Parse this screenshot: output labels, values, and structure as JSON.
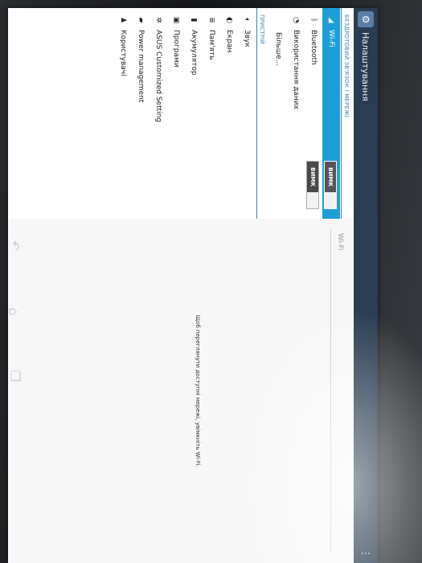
{
  "action_bar": {
    "title": "Налаштування"
  },
  "sections": {
    "wireless_header": "БЕЗДРОТОВИЙ ЗВ'ЯЗОК І МЕРЕЖІ",
    "device_header": "ПРИСТРІЙ"
  },
  "items": {
    "wifi": {
      "label": "Wi-Fi",
      "toggle": "ВИМК"
    },
    "bluetooth": {
      "label": "Bluetooth",
      "toggle": "ВИМК"
    },
    "data_usage": {
      "label": "Використання даних"
    },
    "more": {
      "label": "Більше..."
    },
    "sound": {
      "label": "Звук"
    },
    "display": {
      "label": "Екран"
    },
    "storage": {
      "label": "Пам'ять"
    },
    "battery": {
      "label": "Акумулятор"
    },
    "apps": {
      "label": "Програми"
    },
    "asus": {
      "label": "ASUS Customized Setting"
    },
    "power": {
      "label": "Power management"
    },
    "users": {
      "label": "Користувачі"
    }
  },
  "right_pane": {
    "title": "Wi-Fi",
    "message": "Щоб переглянути доступні мережі, увімкніть Wi-Fi."
  },
  "colors": {
    "action_bar": "#2a3d52",
    "accent": "#1e9ed6",
    "section_header": "#3a7fb5"
  },
  "icons": {
    "back": "back-icon",
    "home": "home-icon",
    "recents": "recents-icon"
  }
}
